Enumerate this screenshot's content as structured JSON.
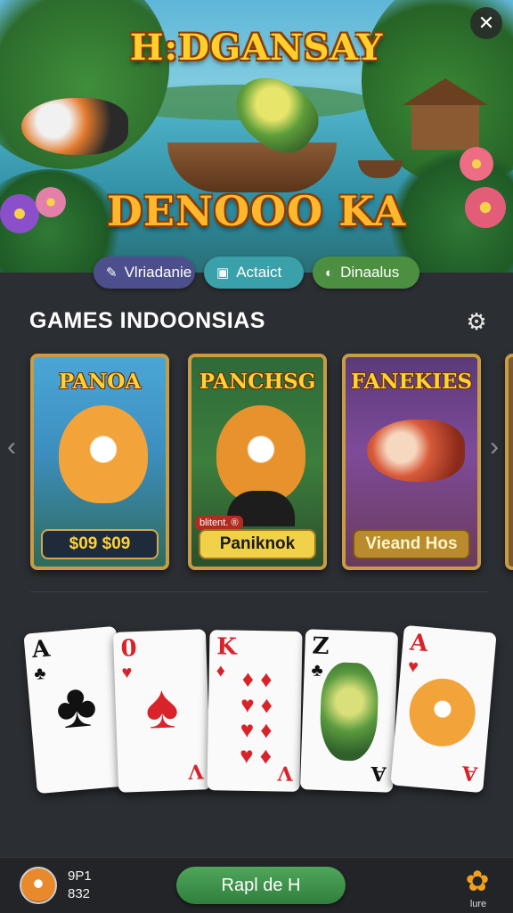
{
  "hero": {
    "title": "H:DGANSAY",
    "subtitle": "DENOOO KA",
    "close_icon": "✕"
  },
  "pills": [
    {
      "icon": "✎",
      "label": "Vlriadanie",
      "color": "#4d4f8c"
    },
    {
      "icon": "▣",
      "label": "Actaict",
      "color": "#3aa0aa"
    },
    {
      "icon": "◐",
      "label": "Dinaalus",
      "color": "#4d8f40"
    }
  ],
  "section": {
    "title": "GAMES INDOONSIAS",
    "settings_icon": "⚙"
  },
  "carousel": {
    "left_arrow": "‹",
    "right_arrow": "›",
    "games": [
      {
        "title": "PANOA",
        "footer": "$09 $09"
      },
      {
        "title": "PANCHSG",
        "badge": "blitent. ®",
        "footer": "Paniknok"
      },
      {
        "title": "FANEKIES",
        "footer": "Vieand Hos"
      }
    ]
  },
  "cards": [
    {
      "rank": "A",
      "mini": "♣",
      "big": "♣",
      "corner": "A",
      "color": "black"
    },
    {
      "rank": "0",
      "mini": "♥",
      "big": "♠",
      "corner": "V",
      "color": "red"
    },
    {
      "rank": "K",
      "mini": "♦",
      "pips": "♦ ♦\n♥ ♦\n♥ ♦\n♥ ♦",
      "corner": "V",
      "color": "red"
    },
    {
      "rank": "Z",
      "mini": "♣",
      "big": "♣",
      "corner": "A",
      "color": "black"
    },
    {
      "rank": "A",
      "mini": "♥",
      "big": "",
      "corner": "A",
      "color": "red"
    }
  ],
  "bottom_bar": {
    "stat_top": "9P1",
    "stat_bottom": "832",
    "main_button": "Rapl de H",
    "flower_icon": "✿",
    "flower_label": "lure"
  }
}
